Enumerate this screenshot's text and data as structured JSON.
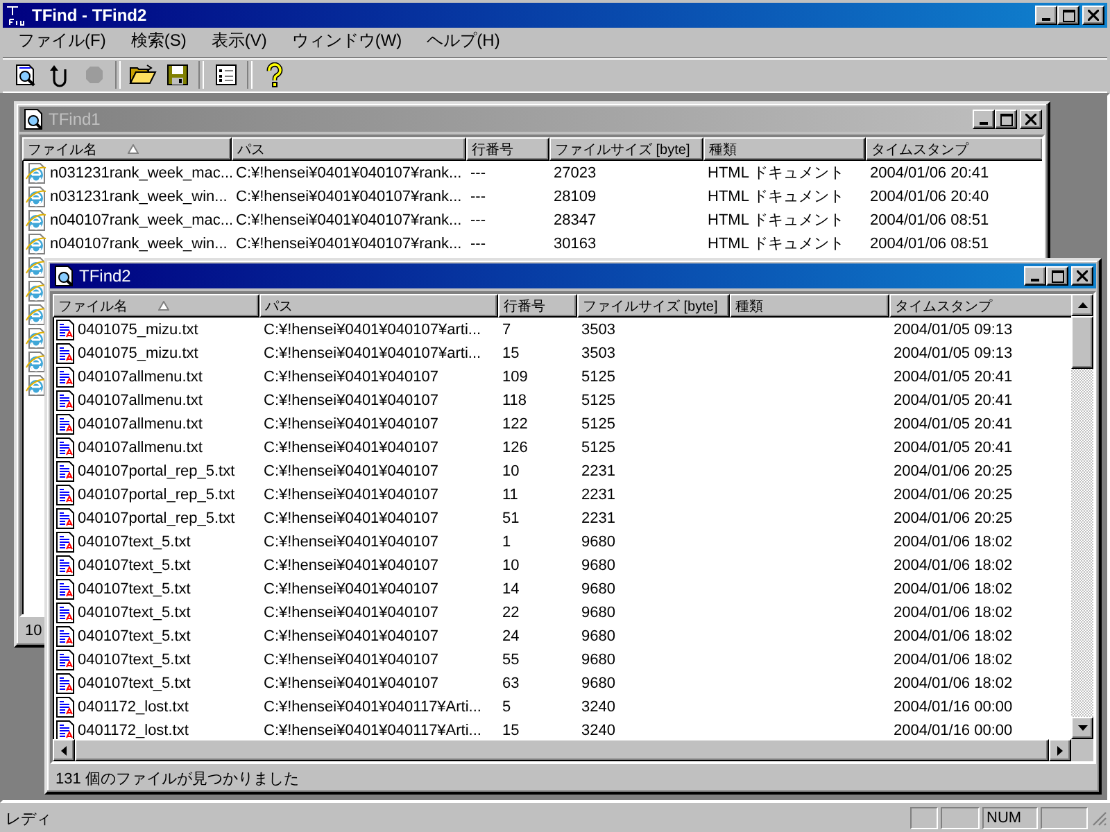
{
  "window": {
    "title": "TFind - TFind2"
  },
  "menu": [
    "ファイル(F)",
    "検索(S)",
    "表示(V)",
    "ウィンドウ(W)",
    "ヘルプ(H)"
  ],
  "toolbar": [
    {
      "kind": "find",
      "disabled": false
    },
    {
      "kind": "refresh",
      "disabled": false
    },
    {
      "kind": "stop",
      "disabled": true
    },
    {
      "kind": "sep"
    },
    {
      "kind": "open",
      "disabled": false
    },
    {
      "kind": "save",
      "disabled": false
    },
    {
      "kind": "sep"
    },
    {
      "kind": "options",
      "disabled": false
    },
    {
      "kind": "sep"
    },
    {
      "kind": "help",
      "disabled": false
    }
  ],
  "children": [
    {
      "title": "TFind1",
      "active": false,
      "kind": "html",
      "columns": [
        {
          "label": "ファイル名",
          "sorted": true
        },
        {
          "label": "パス",
          "sorted": false
        },
        {
          "label": "行番号",
          "sorted": false
        },
        {
          "label": "ファイルサイズ [byte]",
          "sorted": false
        },
        {
          "label": "種類",
          "sorted": false
        },
        {
          "label": "タイムスタンプ",
          "sorted": false
        }
      ],
      "rows": [
        {
          "kind": "full",
          "name": "n031231rank_week_mac...",
          "path": "C:¥!hensei¥0401¥040107¥rank...",
          "line": "---",
          "size": "27023",
          "type": "HTML ドキュメント",
          "timestamp": "2004/01/06 20:41"
        },
        {
          "kind": "full",
          "name": "n031231rank_week_win...",
          "path": "C:¥!hensei¥0401¥040107¥rank...",
          "line": "---",
          "size": "28109",
          "type": "HTML ドキュメント",
          "timestamp": "2004/01/06 20:40"
        },
        {
          "kind": "full",
          "name": "n040107rank_week_mac...",
          "path": "C:¥!hensei¥0401¥040107¥rank...",
          "line": "---",
          "size": "28347",
          "type": "HTML ドキュメント",
          "timestamp": "2004/01/06 08:51"
        },
        {
          "kind": "full",
          "name": "n040107rank_week_win...",
          "path": "C:¥!hensei¥0401¥040107¥rank...",
          "line": "---",
          "size": "30163",
          "type": "HTML ドキュメント",
          "timestamp": "2004/01/06 08:51"
        },
        {
          "kind": "icon_only"
        },
        {
          "kind": "icon_only"
        },
        {
          "kind": "icon_only"
        },
        {
          "kind": "icon_only"
        },
        {
          "kind": "icon_only"
        },
        {
          "kind": "icon_only"
        }
      ],
      "status": "10"
    },
    {
      "title": "TFind2",
      "active": true,
      "kind": "text",
      "columns": [
        {
          "label": "ファイル名",
          "sorted": true
        },
        {
          "label": "パス",
          "sorted": false
        },
        {
          "label": "行番号",
          "sorted": false
        },
        {
          "label": "ファイルサイズ [byte]",
          "sorted": false
        },
        {
          "label": "種類",
          "sorted": false
        },
        {
          "label": "タイムスタンプ",
          "sorted": false
        }
      ],
      "rows": [
        {
          "kind": "full",
          "name": "0401075_mizu.txt",
          "path": "C:¥!hensei¥0401¥040107¥arti...",
          "line": "7",
          "size": "3503",
          "timestamp": "2004/01/05 09:13"
        },
        {
          "kind": "full",
          "name": "0401075_mizu.txt",
          "path": "C:¥!hensei¥0401¥040107¥arti...",
          "line": "15",
          "size": "3503",
          "timestamp": "2004/01/05 09:13"
        },
        {
          "kind": "full",
          "name": "040107allmenu.txt",
          "path": "C:¥!hensei¥0401¥040107",
          "line": "109",
          "size": "5125",
          "timestamp": "2004/01/05 20:41"
        },
        {
          "kind": "full",
          "name": "040107allmenu.txt",
          "path": "C:¥!hensei¥0401¥040107",
          "line": "118",
          "size": "5125",
          "timestamp": "2004/01/05 20:41"
        },
        {
          "kind": "full",
          "name": "040107allmenu.txt",
          "path": "C:¥!hensei¥0401¥040107",
          "line": "122",
          "size": "5125",
          "timestamp": "2004/01/05 20:41"
        },
        {
          "kind": "full",
          "name": "040107allmenu.txt",
          "path": "C:¥!hensei¥0401¥040107",
          "line": "126",
          "size": "5125",
          "timestamp": "2004/01/05 20:41"
        },
        {
          "kind": "full",
          "name": "040107portal_rep_5.txt",
          "path": "C:¥!hensei¥0401¥040107",
          "line": "10",
          "size": "2231",
          "timestamp": "2004/01/06 20:25"
        },
        {
          "kind": "full",
          "name": "040107portal_rep_5.txt",
          "path": "C:¥!hensei¥0401¥040107",
          "line": "11",
          "size": "2231",
          "timestamp": "2004/01/06 20:25"
        },
        {
          "kind": "full",
          "name": "040107portal_rep_5.txt",
          "path": "C:¥!hensei¥0401¥040107",
          "line": "51",
          "size": "2231",
          "timestamp": "2004/01/06 20:25"
        },
        {
          "kind": "full",
          "name": "040107text_5.txt",
          "path": "C:¥!hensei¥0401¥040107",
          "line": "1",
          "size": "9680",
          "timestamp": "2004/01/06 18:02"
        },
        {
          "kind": "full",
          "name": "040107text_5.txt",
          "path": "C:¥!hensei¥0401¥040107",
          "line": "10",
          "size": "9680",
          "timestamp": "2004/01/06 18:02"
        },
        {
          "kind": "full",
          "name": "040107text_5.txt",
          "path": "C:¥!hensei¥0401¥040107",
          "line": "14",
          "size": "9680",
          "timestamp": "2004/01/06 18:02"
        },
        {
          "kind": "full",
          "name": "040107text_5.txt",
          "path": "C:¥!hensei¥0401¥040107",
          "line": "22",
          "size": "9680",
          "timestamp": "2004/01/06 18:02"
        },
        {
          "kind": "full",
          "name": "040107text_5.txt",
          "path": "C:¥!hensei¥0401¥040107",
          "line": "24",
          "size": "9680",
          "timestamp": "2004/01/06 18:02"
        },
        {
          "kind": "full",
          "name": "040107text_5.txt",
          "path": "C:¥!hensei¥0401¥040107",
          "line": "55",
          "size": "9680",
          "timestamp": "2004/01/06 18:02"
        },
        {
          "kind": "full",
          "name": "040107text_5.txt",
          "path": "C:¥!hensei¥0401¥040107",
          "line": "63",
          "size": "9680",
          "timestamp": "2004/01/06 18:02"
        },
        {
          "kind": "full",
          "name": "0401172_lost.txt",
          "path": "C:¥!hensei¥0401¥040117¥Arti...",
          "line": "5",
          "size": "3240",
          "timestamp": "2004/01/16 00:00"
        },
        {
          "kind": "full",
          "name": "0401172_lost.txt",
          "path": "C:¥!hensei¥0401¥040117¥Arti...",
          "line": "15",
          "size": "3240",
          "timestamp": "2004/01/16 00:00"
        }
      ],
      "status": "131 個のファイルが見つかりました"
    }
  ],
  "status_bar": {
    "text": "レディ",
    "panels": [
      {
        "kind": "blank"
      },
      {
        "kind": "blank"
      },
      {
        "kind": "text",
        "text": "NUM"
      },
      {
        "kind": "blank"
      }
    ]
  }
}
